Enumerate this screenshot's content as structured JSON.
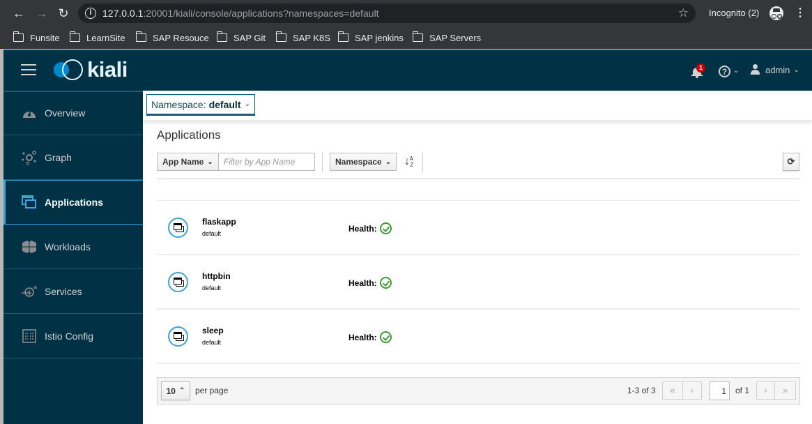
{
  "browser": {
    "url_host": "127.0.0.1",
    "url_rest": ":20001/kiali/console/applications?namespaces=default",
    "profile_label": "Incognito (2)",
    "bookmarks": [
      "Funsite",
      "LearnSite",
      "SAP Resouce",
      "SAP Git",
      "SAP K8S",
      "SAP jenkins",
      "SAP Servers"
    ]
  },
  "masthead": {
    "brand": "kiali",
    "notification_count": "1",
    "help_glyph": "?",
    "user": "admin"
  },
  "sidebar": {
    "items": [
      {
        "label": "Overview",
        "icon": "tachometer-icon",
        "active": false
      },
      {
        "label": "Graph",
        "icon": "topology-icon",
        "active": false
      },
      {
        "label": "Applications",
        "icon": "applications-icon",
        "active": true
      },
      {
        "label": "Workloads",
        "icon": "workloads-icon",
        "active": false
      },
      {
        "label": "Services",
        "icon": "services-icon",
        "active": false
      },
      {
        "label": "Istio Config",
        "icon": "istio-config-icon",
        "active": false
      }
    ]
  },
  "namespace_selector": {
    "label": "Namespace:",
    "value": "default"
  },
  "page": {
    "title": "Applications"
  },
  "filters": {
    "field_dropdown": "App Name",
    "filter_placeholder": "Filter by App Name",
    "sort_dropdown": "Namespace",
    "sort_icon": "sort-alpha-asc-icon",
    "refresh_icon": "refresh-icon"
  },
  "applications": [
    {
      "name": "flaskapp",
      "namespace": "default",
      "health_label": "Health:",
      "health_status": "healthy"
    },
    {
      "name": "httpbin",
      "namespace": "default",
      "health_label": "Health:",
      "health_status": "healthy"
    },
    {
      "name": "sleep",
      "namespace": "default",
      "health_label": "Health:",
      "health_status": "healthy"
    }
  ],
  "pagination": {
    "per_page": "10",
    "per_page_label": "per page",
    "range": "1-3 of 3",
    "current_page": "1",
    "of_pages": "of 1",
    "first": "«",
    "prev": "‹",
    "next": "›",
    "last": "»"
  },
  "colors": {
    "masthead_bg": "#003145",
    "accent": "#39a5dc",
    "healthy": "#3f9c35",
    "badge": "#cc0000"
  }
}
